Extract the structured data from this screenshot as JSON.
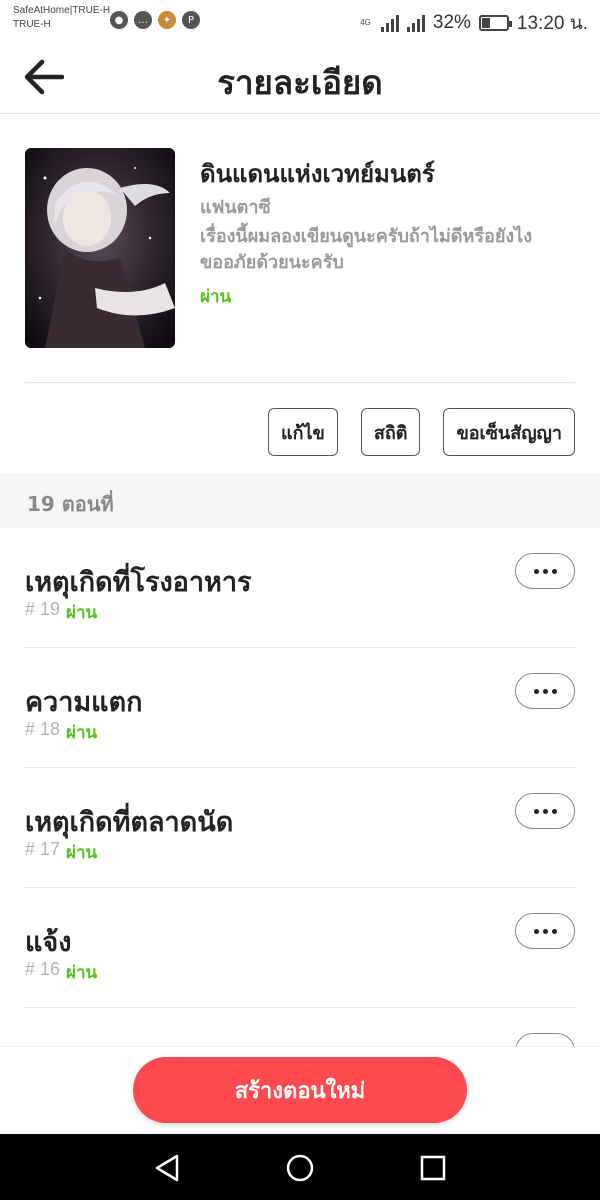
{
  "status_bar": {
    "carrier_line1": "SafeAtHome|TRUE-H",
    "carrier_line2": "TRUE-H",
    "network_tag": "4G",
    "battery_percent": "32%",
    "battery_level": 0.32,
    "time": "13:20 น.",
    "notification_icons": [
      "chrome-icon",
      "chat-icon",
      "game-icon",
      "pinterest-icon"
    ]
  },
  "header": {
    "back_icon": "arrow-left-icon",
    "title": "รายละเอียด"
  },
  "story": {
    "title": "ดินแดนแห่งเวทย์มนตร์",
    "genre": "แฟนตาซี",
    "description": "เรื่องนี้ผมลองเขียนดูนะครับถ้าไม่ดีหรือยังไงขออภัยด้วยนะครับ",
    "status": "ผ่าน",
    "status_color": "#52c41a"
  },
  "actions": {
    "edit_label": "แก้ไข",
    "stats_label": "สถิติ",
    "contract_label": "ขอเซ็นสัญญา"
  },
  "section": {
    "episode_count_label": "19 ตอนที่"
  },
  "episodes": [
    {
      "title": "เหตุเกิดที่โรงอาหาร",
      "number": "# 19",
      "status": "ผ่าน"
    },
    {
      "title": "ความแตก",
      "number": "# 18",
      "status": "ผ่าน"
    },
    {
      "title": "เหตุเกิดที่ตลาดนัด",
      "number": "# 17",
      "status": "ผ่าน"
    },
    {
      "title": "แจ้ง",
      "number": "# 16",
      "status": "ผ่าน"
    }
  ],
  "create": {
    "label": "สร้างตอนใหม่",
    "color": "#ff4a4f"
  },
  "nav": {
    "back_icon": "nav-back-icon",
    "home_icon": "nav-home-icon",
    "recents_icon": "nav-recents-icon"
  }
}
